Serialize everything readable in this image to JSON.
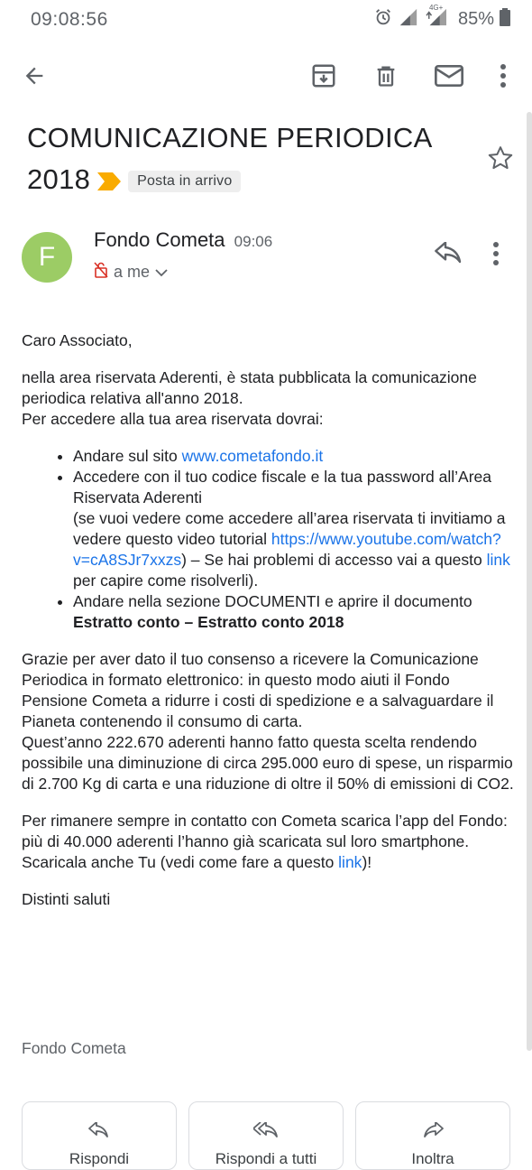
{
  "status_bar": {
    "time": "09:08:56",
    "network": "4G+",
    "battery": "85%"
  },
  "app_bar": {
    "icons": [
      "back-arrow-icon",
      "archive-icon",
      "delete-icon",
      "mail-icon",
      "more-vert-icon"
    ]
  },
  "email": {
    "subject_line1": "COMUNICAZIONE PERIODICA",
    "subject_line2": "2018",
    "label": "Posta in arrivo",
    "sender_initial": "F",
    "sender_name": "Fondo Cometa",
    "sent_time": "09:06",
    "recipient": "a me",
    "body": {
      "greeting": "Caro Associato,",
      "intro1": "nella area riservata Aderenti, è stata pubblicata la comunicazione periodica relativa all'anno 2018.",
      "intro2": "Per accedere alla tua area riservata dovrai:",
      "step1_prefix": "Andare sul sito ",
      "step1_link": "www.cometafondo.it",
      "step2_line1": "Accedere con il tuo codice fiscale e la tua password all’Area Riservata Aderenti",
      "step2_line2": "(se vuoi vedere come accedere all’area riservata ti invitiamo a vedere questo video tutorial ",
      "step2_video_link": "https://www.youtube.com/watch?v=cA8SJr7xxzs",
      "step2_mid": ") – Se hai problemi di accesso vai a questo ",
      "step2_link": "link",
      "step2_end": "  per capire come risolverli).",
      "step3_line1": "Andare nella sezione DOCUMENTI e aprire il documento",
      "step3_bold": "Estratto conto – Estratto conto 2018",
      "para_thanks": "Grazie per aver dato il tuo consenso a ricevere la Comunicazione Periodica in formato elettronico: in questo modo aiuti il Fondo Pensione Cometa a ridurre i costi di spedizione e a salvaguardare il Pianeta contenendo il consumo di carta.",
      "para_stats": "Quest’anno 222.670 aderenti hanno fatto questa scelta rendendo possibile una diminuzione di circa 295.000 euro di spese, un risparmio di 2.700 Kg di carta e una riduzione di oltre il 50% di emissioni di CO2.",
      "para_app": "Per rimanere sempre in contatto con Cometa scarica l’app del Fondo: più di 40.000 aderenti l’hanno già scaricata sul loro smartphone.",
      "para_download_prefix": "Scaricala anche Tu (vedi come fare a questo ",
      "para_download_link": "link",
      "para_download_suffix": ")!",
      "closing": "Distinti saluti"
    },
    "signature": "Fondo Cometa"
  },
  "actions": {
    "reply": "Rispondi",
    "reply_all": "Rispondi a tutti",
    "forward": "Inoltra"
  },
  "colors": {
    "avatar": "#9ccc65",
    "link": "#1a73e8",
    "important_marker": "#f9ab00"
  }
}
